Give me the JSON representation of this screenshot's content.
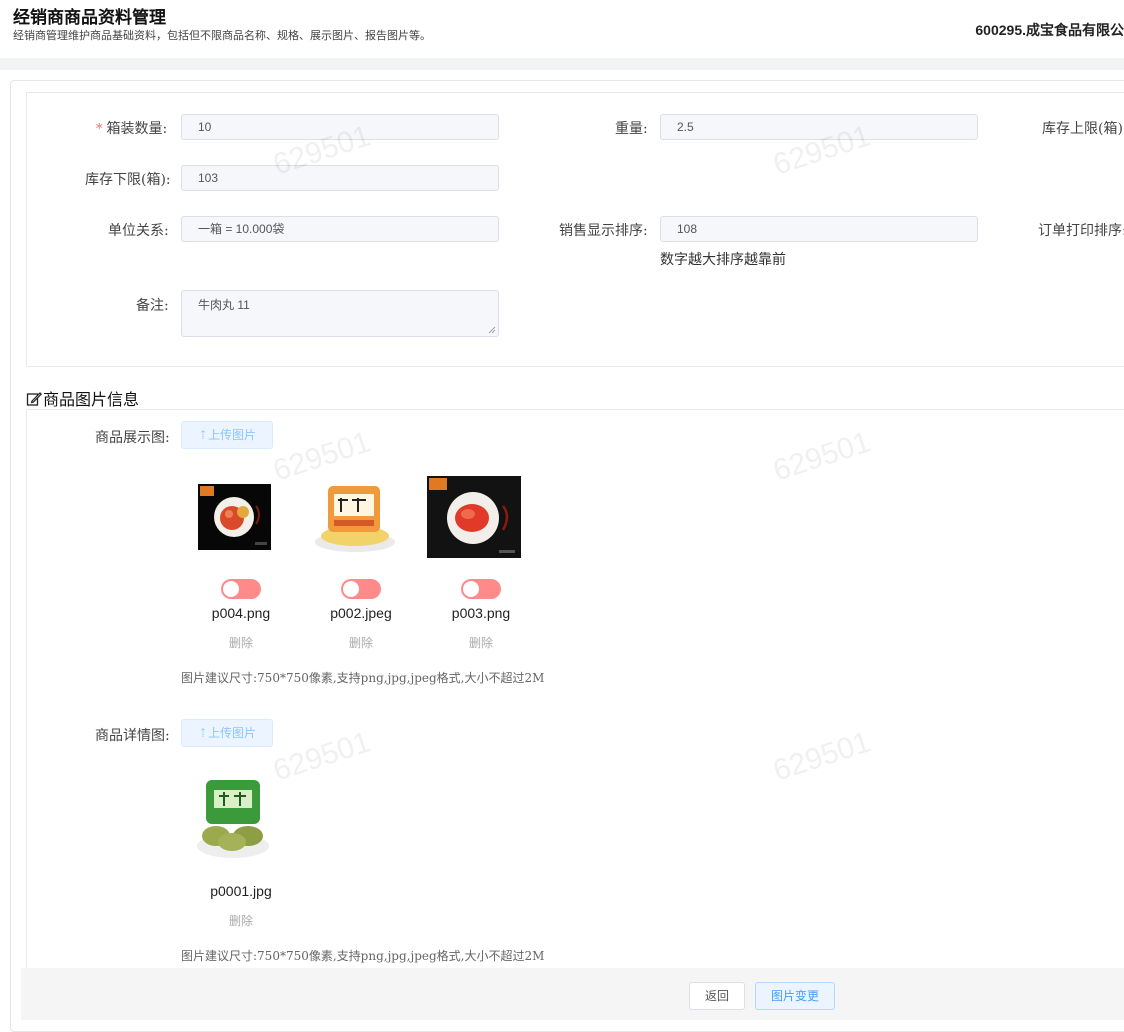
{
  "header": {
    "title": "经销商商品资料管理",
    "subtitle": "经销商管理维护商品基础资料，包括但不限商品名称、规格、展示图片、报告图片等。",
    "company_code": "600295.",
    "company_name": "成宝食品有限公"
  },
  "watermark": "629501",
  "form": {
    "box_qty": {
      "required_mark": "*",
      "label": "箱装数量:",
      "value": "10"
    },
    "weight": {
      "label": "重量:",
      "value": "2.5"
    },
    "stock_upper": {
      "label": "库存上限(箱):"
    },
    "stock_lower": {
      "label": "库存下限(箱):",
      "value": "103"
    },
    "unit_relation": {
      "label": "单位关系:",
      "value": "一箱 = 10.000袋"
    },
    "sales_sort": {
      "label": "销售显示排序:",
      "value": "108",
      "hint": "数字越大排序越靠前"
    },
    "print_sort": {
      "label": "订单打印排序:"
    },
    "remark": {
      "label": "备注:",
      "value": "牛肉丸 11"
    }
  },
  "images_section": {
    "title": "商品图片信息",
    "title_icon": "edit-icon",
    "display": {
      "label": "商品展示图:",
      "upload_label": "上传图片",
      "items": [
        {
          "filename": "p004.png",
          "delete_label": "删除",
          "toggle_on": false
        },
        {
          "filename": "p002.jpeg",
          "delete_label": "删除",
          "toggle_on": false
        },
        {
          "filename": "p003.png",
          "delete_label": "删除",
          "toggle_on": false
        }
      ],
      "tip": "图片建议尺寸:750*750像素,支持png,jpg,jpeg格式,大小不超过2M"
    },
    "detail": {
      "label": "商品详情图:",
      "upload_label": "上传图片",
      "items": [
        {
          "filename": "p0001.jpg",
          "delete_label": "删除"
        }
      ],
      "tip": "图片建议尺寸:750*750像素,支持png,jpg,jpeg格式,大小不超过2M"
    }
  },
  "footer": {
    "back_label": "返回",
    "change_label": "图片变更"
  },
  "colors": {
    "toggle_off": "#ff8a8a",
    "primary": "#409eff",
    "required": "#f56c6c"
  }
}
